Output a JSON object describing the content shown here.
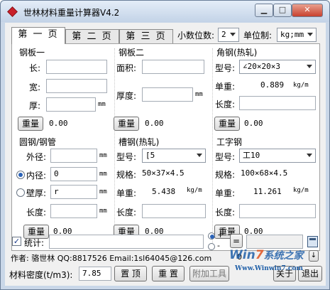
{
  "window": {
    "title": "世林材料重量计算器V4.2",
    "minimize": "▁",
    "maximize": "□",
    "close": "✕"
  },
  "tabs": [
    {
      "label": "第 一 页"
    },
    {
      "label": "第 二 页"
    },
    {
      "label": "第 三 页"
    }
  ],
  "settings": {
    "decimals_label": "小数位数:",
    "decimals_value": "2",
    "units_label": "单位制:",
    "units_value": "kg;mm"
  },
  "plate1": {
    "title": "钢板一",
    "length_label": "长:",
    "width_label": "宽:",
    "thickness_label": "厚:",
    "thickness_unit": "mm",
    "length_value": "",
    "width_value": "",
    "thickness_value": "",
    "weight_button": "重量",
    "weight_value": "0.00"
  },
  "plate2": {
    "title": "钢板二",
    "area_label": "面积:",
    "thickness_label": "厚度:",
    "thickness_unit": "mm",
    "area_value": "",
    "thickness_value": "",
    "weight_button": "重量",
    "weight_value": "0.00"
  },
  "angle": {
    "title": "角钢(热轧)",
    "model_label": "型号:",
    "model_value": "∠20×20×3",
    "unit_weight_label": "单重:",
    "unit_weight_value": "0.889",
    "unit_weight_unit": "kg/m",
    "length_label": "长度:",
    "length_value": "",
    "weight_button": "重量",
    "weight_value": "0.00"
  },
  "pipe": {
    "title": "圆钢/钢管",
    "outer_label": "外径:",
    "outer_unit": "mm",
    "outer_value": "",
    "inner_label": "内径:",
    "inner_unit": "mm",
    "inner_value": "0",
    "wall_label": "壁厚:",
    "wall_unit": "mm",
    "wall_value": "r",
    "length_label": "长度:",
    "length_unit": "mm",
    "length_value": "",
    "weight_button": "重量",
    "weight_value": "0.00"
  },
  "channel": {
    "title": "槽钢(热轧)",
    "model_label": "型号:",
    "model_value": "[5",
    "spec_label": "规格:",
    "spec_value": "50×37×4.5",
    "unit_weight_label": "单重:",
    "unit_weight_value": "5.438",
    "unit_weight_unit": "kg/m",
    "length_label": "长度:",
    "length_value": "",
    "weight_button": "重量",
    "weight_value": "0.00"
  },
  "ibeam": {
    "title": "工字钢",
    "model_label": "型号:",
    "model_value": "工10",
    "spec_label": "规格:",
    "spec_value": "100×68×4.5",
    "unit_weight_label": "单重:",
    "unit_weight_value": "11.261",
    "unit_weight_unit": "kg/m",
    "length_label": "长度:",
    "length_value": "",
    "weight_button": "重量",
    "weight_value": "0.00"
  },
  "stats": {
    "label": "统计:",
    "value": "",
    "plus": "+",
    "minus": "-",
    "equals": "=",
    "result": ""
  },
  "footer": {
    "author": "作者: 骆世林 QQ:8817526  Email:1sl64045@126.com",
    "counter": "0",
    "density_label": "材料密度(t/m3):",
    "density_value": "7.85",
    "pin_button": "置 顶",
    "reset_button": "重 置",
    "tools_button": "附加工具",
    "about_button": "关于",
    "exit_button": "退出"
  },
  "watermark": {
    "text_a": "Win",
    "text_b": "7",
    "text_c": "系统之家",
    "url": "Www.Winwin7.com"
  }
}
